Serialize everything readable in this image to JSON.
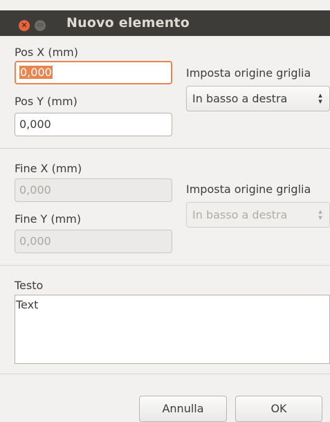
{
  "window": {
    "title": "Nuovo elemento"
  },
  "pos": {
    "x_label": "Pos X (mm)",
    "x_value": "0,000",
    "y_label": "Pos Y (mm)",
    "y_value": "0,000",
    "origin_label": "Imposta origine griglia",
    "origin_value": "In basso a destra"
  },
  "end": {
    "x_label": "Fine X (mm)",
    "x_value": "0,000",
    "y_label": "Fine Y (mm)",
    "y_value": "0,000",
    "origin_label": "Imposta origine griglia",
    "origin_value": "In basso a destra"
  },
  "text": {
    "label": "Testo",
    "value": "Text"
  },
  "buttons": {
    "cancel": "Annulla",
    "ok": "OK"
  },
  "icons": {
    "close": "close-icon",
    "minimize": "minimize-icon",
    "spinner": "updown-arrows-icon"
  },
  "colors": {
    "titlebar": "#3d3c38",
    "focus_accent": "#e9854f",
    "close_button": "#e8643c"
  }
}
